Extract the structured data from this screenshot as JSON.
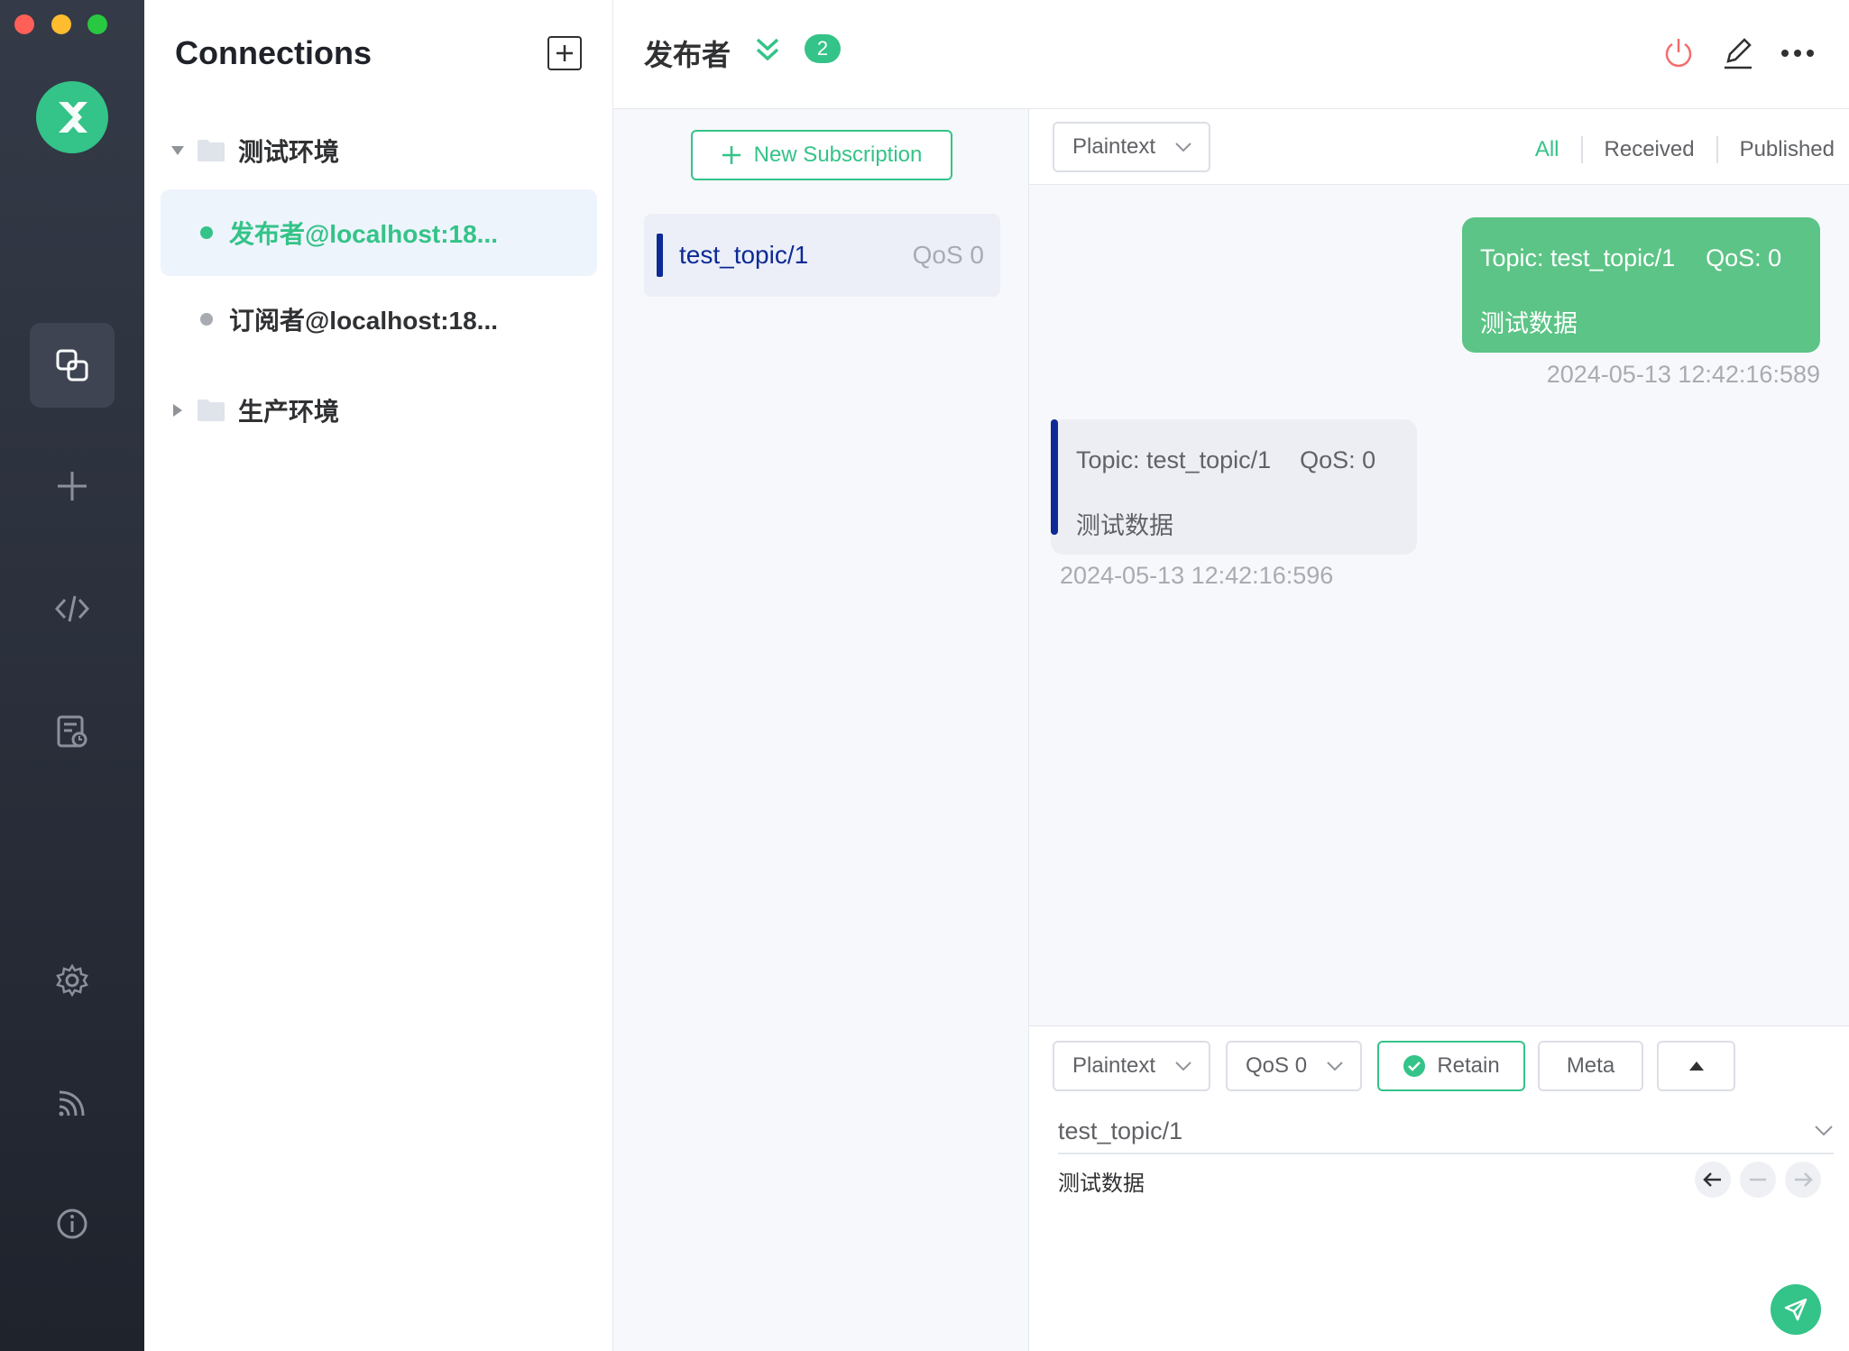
{
  "sidebar_nav": {
    "items": [
      {
        "icon": "connections-icon",
        "active": true
      },
      {
        "icon": "plus-icon"
      },
      {
        "icon": "code-icon"
      },
      {
        "icon": "log-icon"
      },
      {
        "icon": "settings-icon"
      },
      {
        "icon": "rss-icon"
      },
      {
        "icon": "info-icon"
      }
    ]
  },
  "connections": {
    "title": "Connections",
    "groups": [
      {
        "name": "测试环境",
        "expanded": true,
        "items": [
          {
            "name": "发布者@localhost:18...",
            "status": "connected",
            "active": true
          },
          {
            "name": "订阅者@localhost:18...",
            "status": "disconnected",
            "active": false
          }
        ]
      },
      {
        "name": "生产环境",
        "expanded": false,
        "items": []
      }
    ]
  },
  "header": {
    "title": "发布者",
    "badge_count": "2"
  },
  "subscriptions": {
    "new_button": "New Subscription",
    "items": [
      {
        "topic": "test_topic/1",
        "qos": "QoS 0",
        "color": "#0d2a96"
      }
    ]
  },
  "message_filter": {
    "format": "Plaintext",
    "tabs": [
      "All",
      "Received",
      "Published"
    ],
    "active_tab": "All"
  },
  "messages": [
    {
      "direction": "published",
      "topic_line": "Topic: test_topic/1",
      "qos_line": "QoS: 0",
      "payload": "测试数据",
      "time": "2024-05-13 12:42:16:589"
    },
    {
      "direction": "received",
      "topic_line": "Topic: test_topic/1",
      "qos_line": "QoS: 0",
      "payload": "测试数据",
      "time": "2024-05-13 12:42:16:596"
    }
  ],
  "publish": {
    "format": "Plaintext",
    "qos": "QoS 0",
    "retain_label": "Retain",
    "retain_checked": true,
    "meta_label": "Meta",
    "topic": "test_topic/1",
    "payload": "测试数据"
  },
  "colors": {
    "accent": "#34c388",
    "topic_color": "#0d2a96",
    "rail_bg": "#2a2f3b"
  }
}
